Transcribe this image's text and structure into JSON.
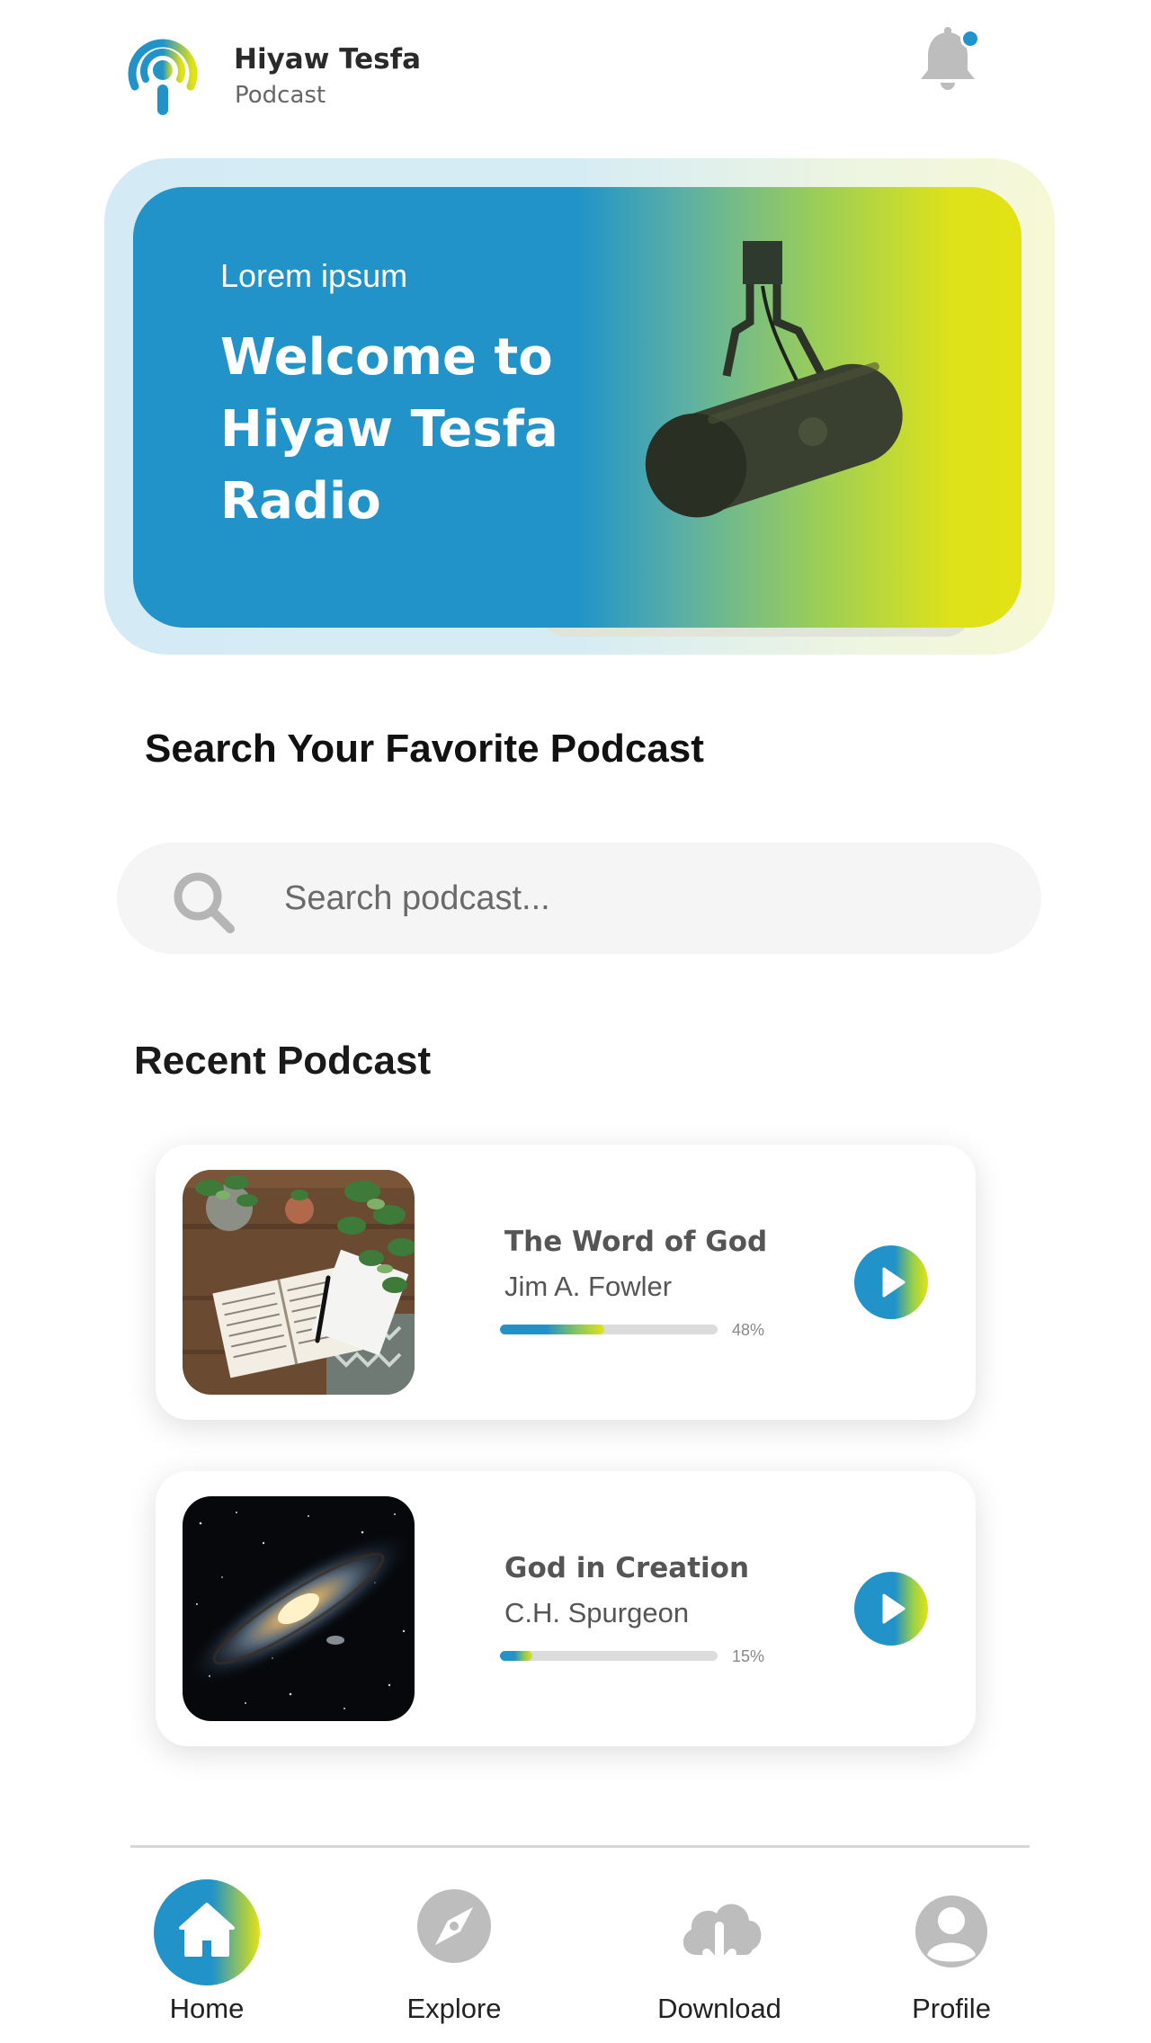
{
  "header": {
    "app_name": "Hiyaw Tesfa",
    "app_subtitle": "Podcast",
    "notification_dot": true
  },
  "hero": {
    "kicker": "Lorem ipsum",
    "title": "Welcome to Hiyaw Tesfa Radio"
  },
  "search": {
    "heading": "Search Your Favorite Podcast",
    "placeholder": "Search podcast..."
  },
  "recent": {
    "heading": "Recent Podcast",
    "items": [
      {
        "title": "The Word of God",
        "author": "Jim A. Fowler",
        "progress_label": "48%",
        "progress": 0.48,
        "thumbnail": "bible-and-plants"
      },
      {
        "title": "God in Creation",
        "author": "C.H. Spurgeon",
        "progress_label": "15%",
        "progress": 0.15,
        "thumbnail": "galaxy"
      }
    ]
  },
  "nav": {
    "items": [
      {
        "label": "Home",
        "icon": "home-icon",
        "active": true
      },
      {
        "label": "Explore",
        "icon": "compass-icon",
        "active": false
      },
      {
        "label": "Download",
        "icon": "cloud-download-icon",
        "active": false
      },
      {
        "label": "Profile",
        "icon": "user-icon",
        "active": false
      }
    ]
  },
  "colors": {
    "accent_blue": "#2193c8",
    "accent_yellow": "#e3e313",
    "icon_gray": "#bdbdbd",
    "text_dark": "#111111"
  }
}
